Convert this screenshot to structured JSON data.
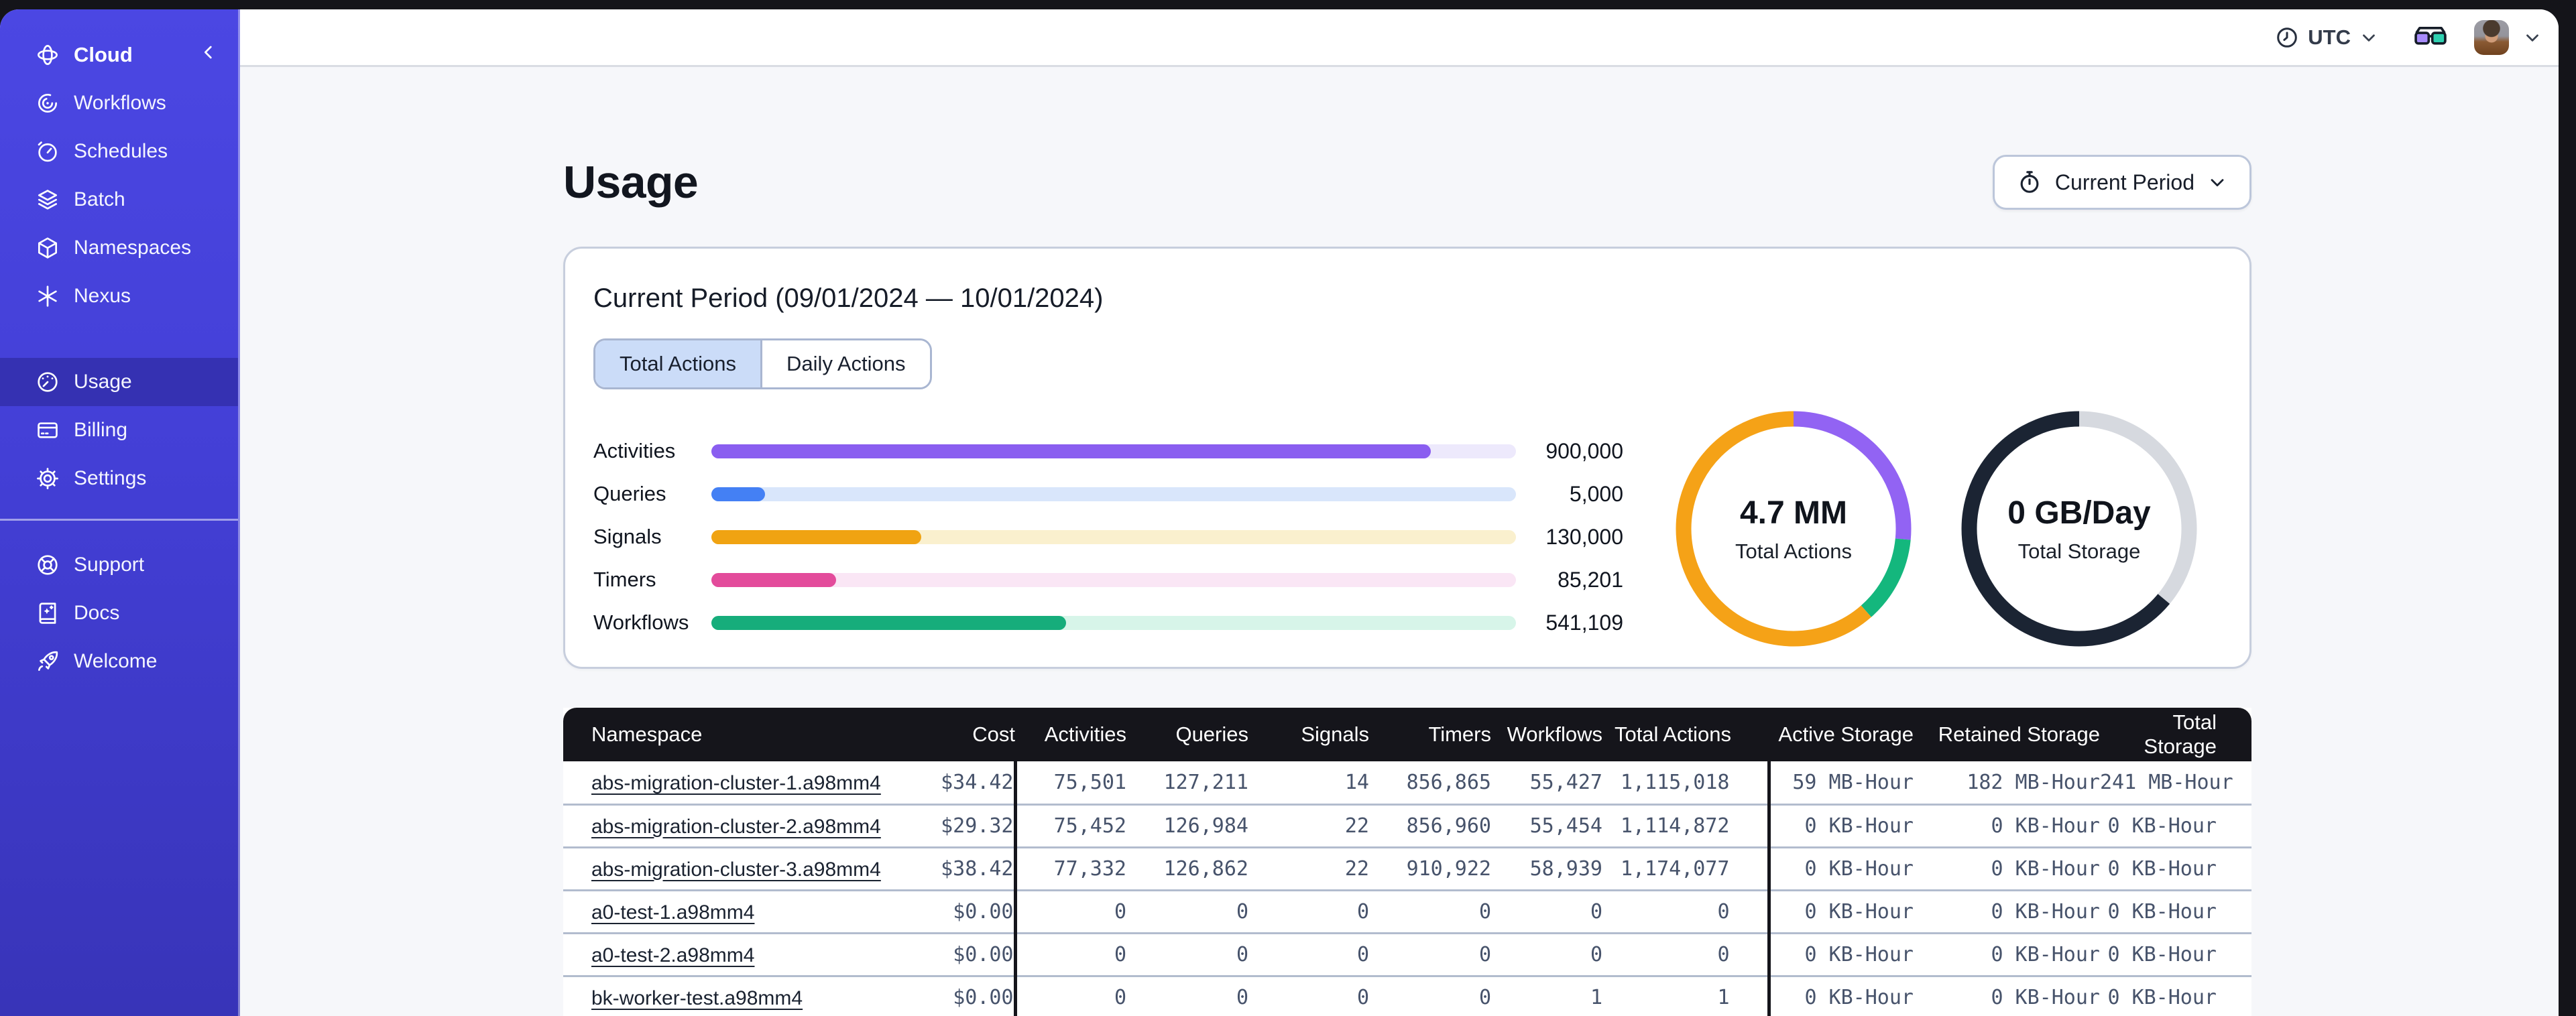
{
  "sidebar": {
    "brand_label": "Cloud",
    "items": [
      {
        "label": "Workflows"
      },
      {
        "label": "Schedules"
      },
      {
        "label": "Batch"
      },
      {
        "label": "Namespaces"
      },
      {
        "label": "Nexus"
      }
    ],
    "account_items": [
      {
        "label": "Usage",
        "active": true
      },
      {
        "label": "Billing",
        "active": false
      },
      {
        "label": "Settings",
        "active": false
      }
    ],
    "footer_items": [
      {
        "label": "Support"
      },
      {
        "label": "Docs"
      },
      {
        "label": "Welcome"
      }
    ]
  },
  "topbar": {
    "timezone_label": "UTC"
  },
  "page": {
    "title": "Usage",
    "period_button_label": "Current Period"
  },
  "usage_card": {
    "title": "Current Period (09/01/2024 — 10/01/2024)",
    "tabs": [
      {
        "label": "Total Actions",
        "active": true
      },
      {
        "label": "Daily Actions",
        "active": false
      }
    ]
  },
  "chart_data": [
    {
      "type": "bar",
      "orientation": "horizontal",
      "title": "Total Actions by type",
      "categories": [
        "Activities",
        "Queries",
        "Signals",
        "Timers",
        "Workflows"
      ],
      "values": [
        900000,
        5000,
        130000,
        85201,
        541109
      ],
      "display_values": [
        "900,000",
        "5,000",
        "130,000",
        "85,201",
        "541,109"
      ],
      "fill_pct": [
        89.4,
        6.7,
        26.1,
        15.5,
        44.1
      ],
      "colors": [
        "#8A5EF0",
        "#4480F4",
        "#F0A312",
        "#E34B9B",
        "#16AD7B"
      ],
      "track_colors": [
        "#EDE9FC",
        "#D9E6FB",
        "#FAF0CE",
        "#FAE6F5",
        "#D7F5E9"
      ]
    },
    {
      "type": "donut",
      "title": "Total Actions",
      "center_label": "4.7 MM",
      "sub_label": "Total Actions",
      "segments": [
        {
          "name": "Activities",
          "color": "#9263F3",
          "pct": 26.5
        },
        {
          "name": "Workflows",
          "color": "#14B77D",
          "pct": 12
        },
        {
          "name": "Signals",
          "color": "#F5A217",
          "pct": 61.5
        }
      ]
    },
    {
      "type": "donut",
      "title": "Total Storage",
      "center_label": "0 GB/Day",
      "sub_label": "Total Storage",
      "segments": [
        {
          "name": "retained",
          "color": "#D6D9DF",
          "pct": 36
        },
        {
          "name": "active",
          "color": "#1B2433",
          "pct": 64
        }
      ]
    }
  ],
  "table": {
    "headers": [
      "Namespace",
      "Cost",
      "Activities",
      "Queries",
      "Signals",
      "Timers",
      "Workflows",
      "Total Actions",
      "Active Storage",
      "Retained Storage",
      "Total Storage"
    ],
    "rows": [
      [
        "abs-migration-cluster-1.a98mm4",
        "$34.42",
        "75,501",
        "127,211",
        "14",
        "856,865",
        "55,427",
        "1,115,018",
        "59 MB-Hour",
        "182 MB-Hour",
        "241 MB-Hour"
      ],
      [
        "abs-migration-cluster-2.a98mm4",
        "$29.32",
        "75,452",
        "126,984",
        "22",
        "856,960",
        "55,454",
        "1,114,872",
        "0 KB-Hour",
        "0 KB-Hour",
        "0 KB-Hour"
      ],
      [
        "abs-migration-cluster-3.a98mm4",
        "$38.42",
        "77,332",
        "126,862",
        "22",
        "910,922",
        "58,939",
        "1,174,077",
        "0 KB-Hour",
        "0 KB-Hour",
        "0 KB-Hour"
      ],
      [
        "a0-test-1.a98mm4",
        "$0.00",
        "0",
        "0",
        "0",
        "0",
        "0",
        "0",
        "0 KB-Hour",
        "0 KB-Hour",
        "0 KB-Hour"
      ],
      [
        "a0-test-2.a98mm4",
        "$0.00",
        "0",
        "0",
        "0",
        "0",
        "0",
        "0",
        "0 KB-Hour",
        "0 KB-Hour",
        "0 KB-Hour"
      ],
      [
        "bk-worker-test.a98mm4",
        "$0.00",
        "0",
        "0",
        "0",
        "0",
        "1",
        "1",
        "0 KB-Hour",
        "0 KB-Hour",
        "0 KB-Hour"
      ]
    ]
  },
  "colors": {
    "sidebar_top": "#4B47E3",
    "sidebar_bottom": "#3834B8",
    "table_header_bg": "#15151B",
    "tab_selected_bg": "#CBDCF8",
    "glasses_left_lens": "#A78BFA",
    "glasses_right_lens": "#2FD0B0"
  }
}
